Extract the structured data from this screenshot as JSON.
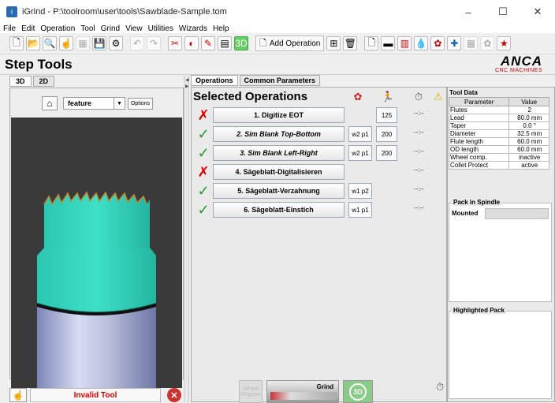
{
  "window": {
    "title": "iGrind - P:\\toolroom\\user\\tools\\Sawblade-Sample.tom",
    "minimize": "–",
    "maximize": "☐",
    "close": "✕"
  },
  "menu": [
    "File",
    "Edit",
    "Operation",
    "Tool",
    "Grind",
    "View",
    "Utilities",
    "Wizards",
    "Help"
  ],
  "toolbar": {
    "add_operation": "Add Operation"
  },
  "header": {
    "title": "Step Tools",
    "brand": "ANCA",
    "brand_sub": "CNC MACHINES"
  },
  "left": {
    "tabs": [
      "3D",
      "2D"
    ],
    "feature_value": "feature",
    "options_label": "Options",
    "invalid_label": "Invalid Tool"
  },
  "right": {
    "tabs": [
      "Operations",
      "Common Parameters"
    ],
    "selected_title": "Selected Operations",
    "operations": [
      {
        "status": "bad",
        "name": "1. Digitize EOT",
        "wheel": "",
        "feed": "125",
        "time": "--:--",
        "italic": false
      },
      {
        "status": "ok",
        "name": "2. Sim Blank Top-Bottom",
        "wheel": "w2 p1",
        "feed": "200",
        "time": "--:--",
        "italic": true
      },
      {
        "status": "ok",
        "name": "3. Sim Blank Left-Right",
        "wheel": "w2 p1",
        "feed": "200",
        "time": "--:--",
        "italic": true
      },
      {
        "status": "bad",
        "name": "4. Sägeblatt-Digitalisieren",
        "wheel": "",
        "feed": "",
        "time": "--:--",
        "italic": false
      },
      {
        "status": "ok",
        "name": "5. Sägeblatt-Verzahnung",
        "wheel": "w1 p2",
        "feed": "",
        "time": "--:--",
        "italic": false
      },
      {
        "status": "ok",
        "name": "6. Sägeblatt-Einstich",
        "wheel": "w1 p1",
        "feed": "",
        "time": "--:--",
        "italic": false
      }
    ],
    "bottom": {
      "wheel_register": "Wheel Register",
      "grind_label": "Grind",
      "btn_3d": "3D"
    }
  },
  "tool_data": {
    "title": "Tool Data",
    "columns": [
      "Parameter",
      "Value"
    ],
    "rows": [
      [
        "Flutes",
        "2"
      ],
      [
        "Lead",
        "80.0 mm"
      ],
      [
        "Taper",
        "0.0 °"
      ],
      [
        "Diameter",
        "32.5 mm"
      ],
      [
        "Flute length",
        "60.0 mm"
      ],
      [
        "OD length",
        "60.0 mm"
      ],
      [
        "Wheel comp.",
        "inactive"
      ],
      [
        "Collet Protect",
        "active"
      ]
    ]
  },
  "pack_in_spindle": {
    "title": "Pack in Spindle",
    "mounted_label": "Mounted"
  },
  "highlighted_pack": {
    "title": "Highlighted Pack"
  }
}
